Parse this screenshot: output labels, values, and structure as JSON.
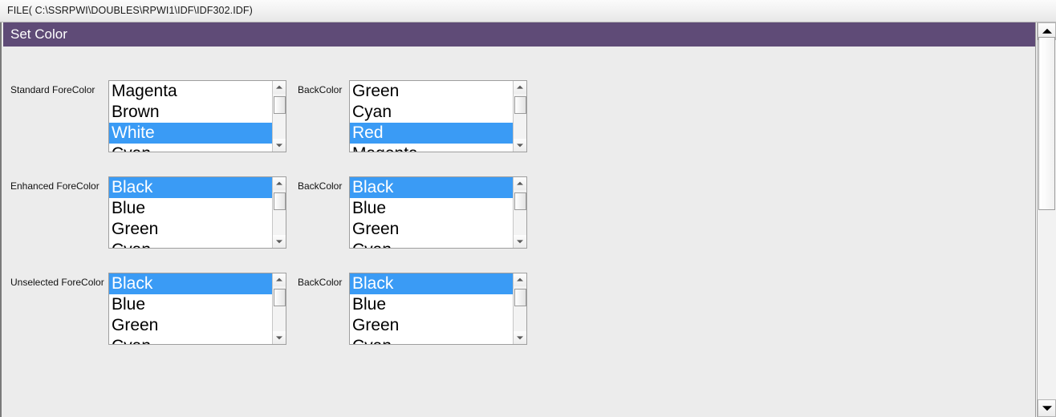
{
  "filebar": {
    "path_text": "FILE( C:\\SSRPWI\\DOUBLES\\RPWI1\\IDF\\IDF302.IDF)"
  },
  "window": {
    "title": "Set Color",
    "title_bg": "#5f4b77",
    "surface_bg": "#ececec",
    "selection_bg": "#3a9bf5",
    "selection_fg": "#ffffff"
  },
  "rows": [
    {
      "fore_label": "Standard ForeColor",
      "back_label": "BackColor",
      "fore_items": [
        {
          "label": "Magenta",
          "selected": false
        },
        {
          "label": "Brown",
          "selected": false
        },
        {
          "label": "White",
          "selected": true
        },
        {
          "label": "Cyan",
          "selected": false
        }
      ],
      "back_items": [
        {
          "label": "Green",
          "selected": false
        },
        {
          "label": "Cyan",
          "selected": false
        },
        {
          "label": "Red",
          "selected": true
        },
        {
          "label": "Magenta",
          "selected": false
        }
      ]
    },
    {
      "fore_label": "Enhanced ForeColor",
      "back_label": "BackColor",
      "fore_items": [
        {
          "label": "Black",
          "selected": true
        },
        {
          "label": "Blue",
          "selected": false
        },
        {
          "label": "Green",
          "selected": false
        },
        {
          "label": "Cyan",
          "selected": false
        }
      ],
      "back_items": [
        {
          "label": "Black",
          "selected": true
        },
        {
          "label": "Blue",
          "selected": false
        },
        {
          "label": "Green",
          "selected": false
        },
        {
          "label": "Cyan",
          "selected": false
        }
      ]
    },
    {
      "fore_label": "Unselected ForeColor",
      "back_label": "BackColor",
      "fore_items": [
        {
          "label": "Black",
          "selected": true
        },
        {
          "label": "Blue",
          "selected": false
        },
        {
          "label": "Green",
          "selected": false
        },
        {
          "label": "Cyan",
          "selected": false
        }
      ],
      "back_items": [
        {
          "label": "Black",
          "selected": true
        },
        {
          "label": "Blue",
          "selected": false
        },
        {
          "label": "Green",
          "selected": false
        },
        {
          "label": "Cyan",
          "selected": false
        }
      ]
    }
  ],
  "scrollbar": {
    "up_arrow_icon": "triangle-up-icon",
    "down_arrow_icon": "triangle-down-icon"
  }
}
